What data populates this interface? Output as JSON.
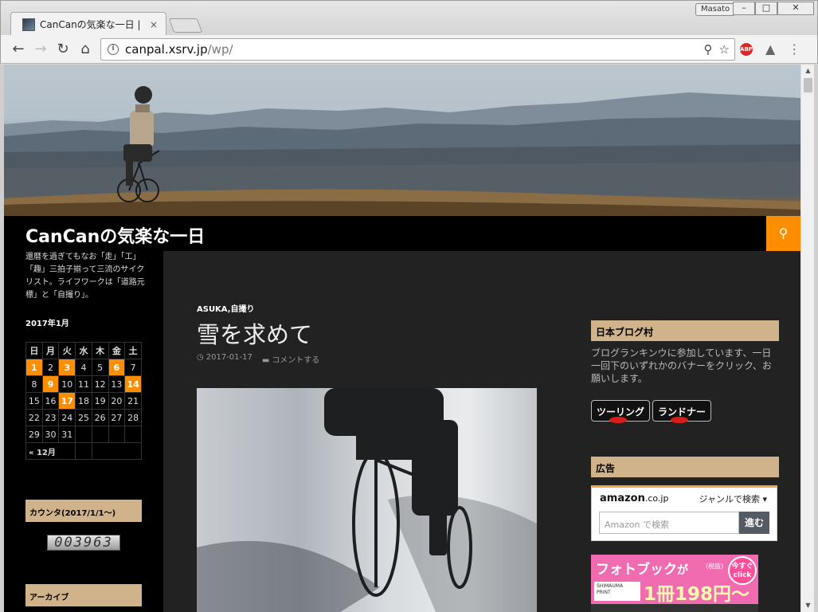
{
  "browser": {
    "tab_title": "CanCanの気楽な一日 | ",
    "tab_close": "×",
    "profile_name": "Masato",
    "url_host": "canpal.xsrv.jp",
    "url_path": "/wp/",
    "win_min": "–",
    "win_max": "□",
    "win_close": "✕"
  },
  "site": {
    "title": "CanCanの気楽な一日",
    "tagline": "還暦を過ぎてもなお「走」「工」「趣」三拍子揃って三流のサイクリスト。ライフワークは「道路元標」と「自撮り」。"
  },
  "calendar": {
    "title": "2017年1月",
    "weekdays": [
      "日",
      "月",
      "火",
      "水",
      "木",
      "金",
      "土"
    ],
    "weeks": [
      [
        "1",
        "2",
        "3",
        "4",
        "5",
        "6",
        "7"
      ],
      [
        "8",
        "9",
        "10",
        "11",
        "12",
        "13",
        "14"
      ],
      [
        "15",
        "16",
        "17",
        "18",
        "19",
        "20",
        "21"
      ],
      [
        "22",
        "23",
        "24",
        "25",
        "26",
        "27",
        "28"
      ],
      [
        "29",
        "30",
        "31",
        "",
        "",
        "",
        ""
      ]
    ],
    "highlighted_days": [
      "1",
      "3",
      "6",
      "9",
      "14",
      "17"
    ],
    "prev_link": "« 12月"
  },
  "widgets": {
    "counter_title": "カウンタ(2017/1/1〜)",
    "counter_value": "003963",
    "archive_title": "アーカイブ",
    "blogmura_title": "日本ブログ村",
    "blogmura_text": "ブログランキンウに参加しています、一日一回下のいずれかのバナーをクリック、お願いします。",
    "btn_touring": "ツーリング",
    "btn_randonneur": "ランドナー",
    "ads_title": "広告"
  },
  "post": {
    "categories": "ASUKA,自撮り",
    "title": "雪を求めて",
    "date": "2017-01-17",
    "comment": "コメントする"
  },
  "amazon": {
    "logo": "amazon",
    "logo_suffix": ".co.jp",
    "genre": "ジャンルで検索",
    "placeholder": "Amazon で検索",
    "go": "進む"
  },
  "photobook": {
    "title": "フォトブック",
    "ga": "が",
    "tax": "(税抜)",
    "click": "今すぐ click",
    "brand": "SHIMAUMA PRINT",
    "price": "1冊198円〜"
  },
  "colors": {
    "accent": "#ff8d00",
    "widget_bg": "#d1b38b"
  }
}
